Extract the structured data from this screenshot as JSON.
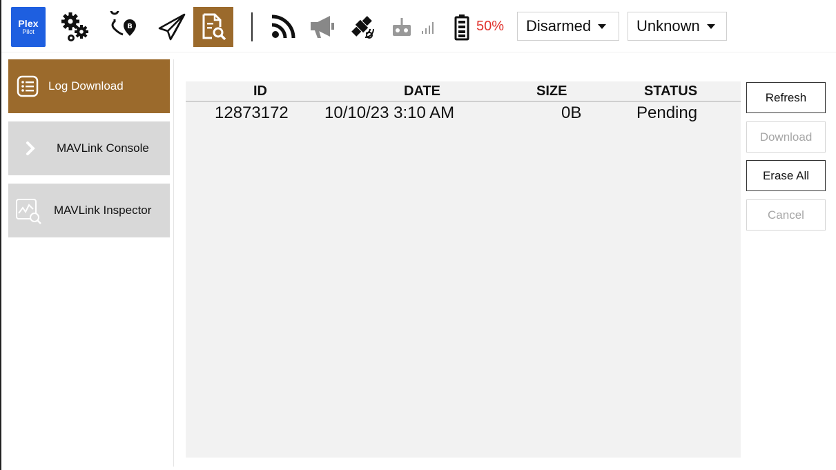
{
  "app": {
    "logo_line1": "Plex",
    "logo_line2": "Pilot"
  },
  "toolbar": {
    "icons": [
      "settings-gears-icon",
      "plan-route-icon",
      "fly-paper-plane-icon",
      "analyze-document-icon",
      "telemetry-signal-icon",
      "megaphone-icon",
      "gps-satellite-icon",
      "rc-remote-icon",
      "signal-bars-icon",
      "battery-icon"
    ],
    "battery_percent": "50%",
    "armed_status": "Disarmed",
    "flight_mode": "Unknown"
  },
  "sidebar": {
    "items": [
      {
        "label": "Log Download",
        "icon": "list-icon",
        "active": true
      },
      {
        "label": "MAVLink Console",
        "icon": "chevron-right-icon",
        "active": false
      },
      {
        "label": "MAVLink Inspector",
        "icon": "inspector-chart-icon",
        "active": false
      }
    ]
  },
  "table": {
    "headers": {
      "id": "ID",
      "date": "DATE",
      "size": "SIZE",
      "status": "STATUS"
    },
    "rows": [
      {
        "id": "12873172",
        "date": "10/10/23 3:10 AM",
        "size": "0B",
        "status": "Pending"
      }
    ]
  },
  "actions": {
    "refresh": "Refresh",
    "download": "Download",
    "erase_all": "Erase All",
    "cancel": "Cancel"
  },
  "colors": {
    "accent": "#9b6a2c",
    "logo_bg": "#1e5fe0",
    "battery_low": "#e0302a"
  }
}
